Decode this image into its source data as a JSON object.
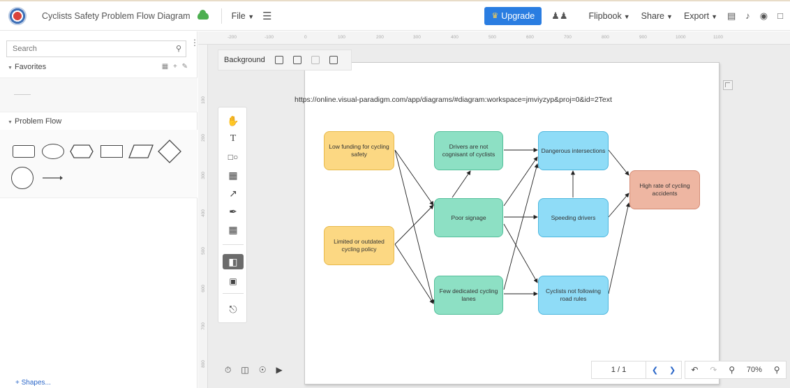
{
  "topbar": {
    "doc_title": "Cyclists Safety Problem Flow Diagram",
    "file_menu": "File",
    "upgrade_label": "Upgrade",
    "flipbook_label": "Flipbook",
    "share_label": "Share",
    "export_label": "Export"
  },
  "sidebar": {
    "search_placeholder": "Search",
    "favorites_label": "Favorites",
    "problem_flow_label": "Problem Flow",
    "add_shapes_label": "+ Shapes..."
  },
  "rulers": {
    "top": [
      "-200",
      "-100",
      "0",
      "100",
      "200",
      "300",
      "400",
      "500",
      "600",
      "700",
      "800",
      "900",
      "1000",
      "1100"
    ],
    "left": [
      "100",
      "200",
      "300",
      "400",
      "500",
      "600",
      "700",
      "800"
    ]
  },
  "canvas": {
    "background_label": "Background",
    "page_indicator": "1 / 1",
    "zoom_level": "70%"
  },
  "diagram": {
    "url_text": "https://online.visual-paradigm.com/app/diagrams/#diagram:workspace=jmviyzyp&proj=0&id=2Text",
    "nodes": {
      "low_funding": "Low funding for cycling safety",
      "limited_policy": "Limited or outdated cycling policy",
      "not_cognisant": "Drivers are not cognisant of cyclists",
      "poor_signage": "Poor signage",
      "few_lanes": "Few dedicated cycling lanes",
      "dangerous_intersections": "Dangerous intersections",
      "speeding": "Speeding drivers",
      "not_following": "Cyclists not following road rules",
      "high_rate": "High rate of cycling accidents"
    },
    "colors": {
      "cause": "#fcd883",
      "intermediate": "#8de0c4",
      "factor": "#8fdcf7",
      "effect": "#eeb6a2"
    }
  }
}
